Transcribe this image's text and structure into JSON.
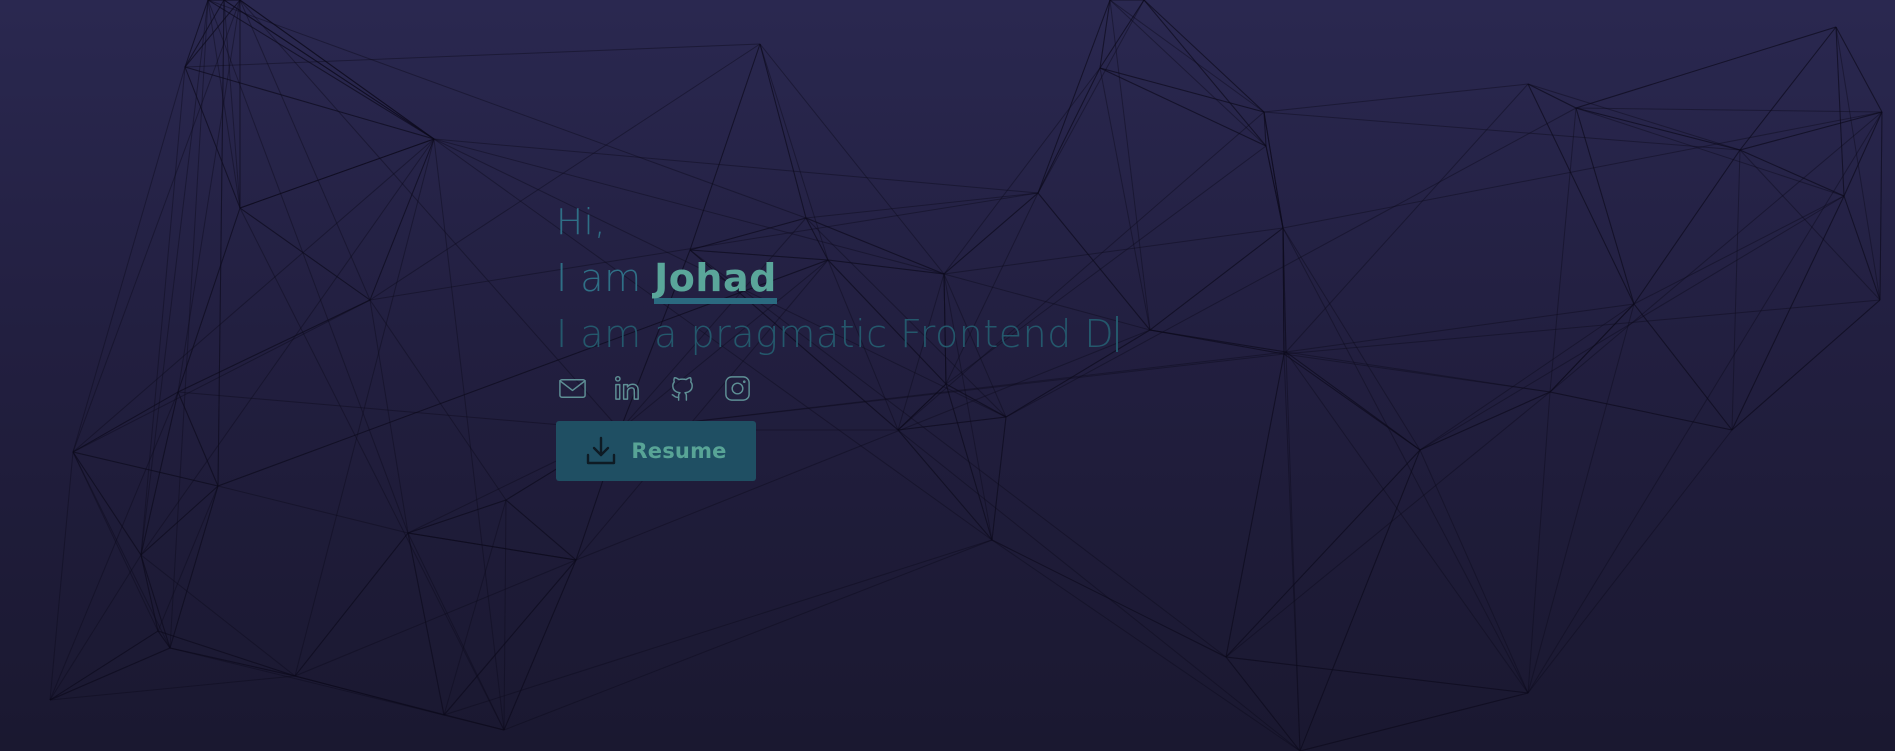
{
  "hero": {
    "greeting": "Hi,",
    "intro_prefix": "I am ",
    "name": "Johad",
    "tagline": "I am a pragmatic Frontend D"
  },
  "socials": [
    {
      "icon": "mail-icon"
    },
    {
      "icon": "linkedin-icon"
    },
    {
      "icon": "github-icon"
    },
    {
      "icon": "instagram-icon"
    }
  ],
  "resume_button": {
    "label": "Resume",
    "icon": "download-icon"
  },
  "colors": {
    "background_top": "#2a2850",
    "background_bottom": "#1a1830",
    "accent": "#5aa69a",
    "text_muted": "#2f6f86",
    "button_bg": "#1f4f63"
  }
}
